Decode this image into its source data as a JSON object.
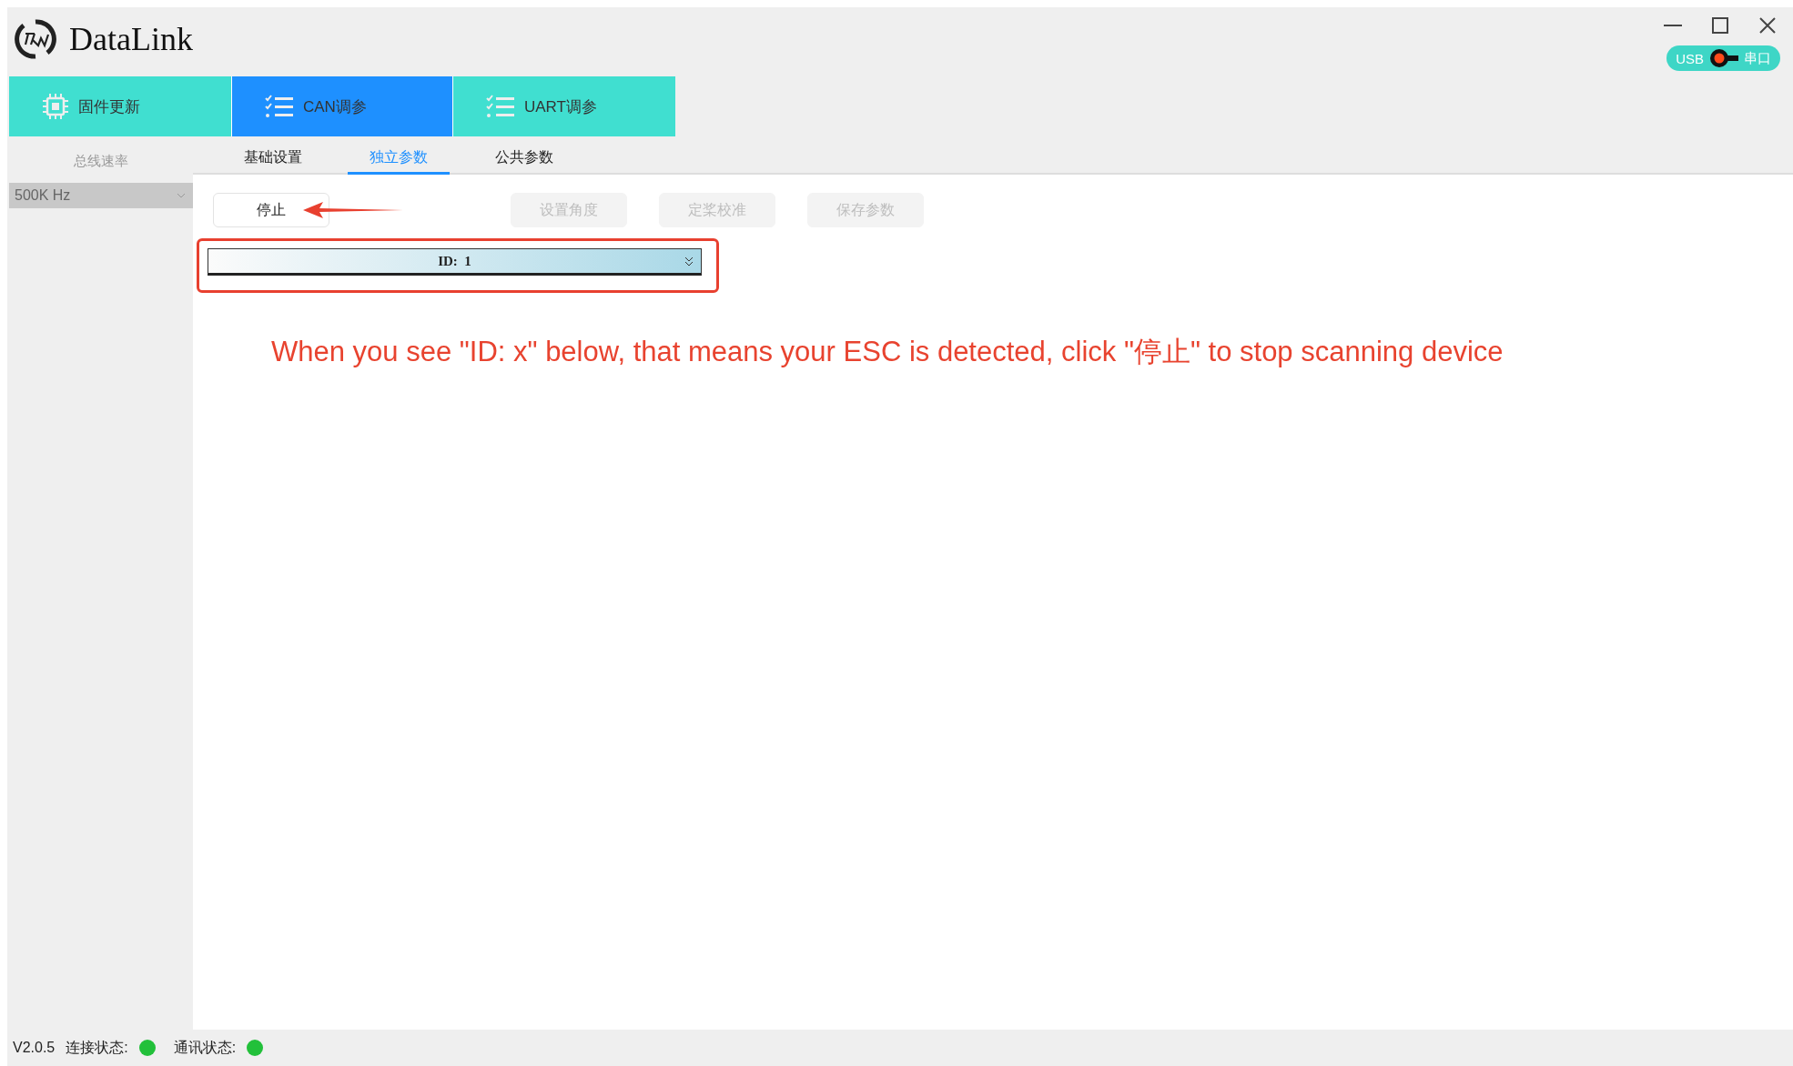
{
  "window": {
    "title": "DataLink"
  },
  "window_controls": [
    {
      "kind": "minimize"
    },
    {
      "kind": "maximize"
    },
    {
      "kind": "close"
    }
  ],
  "connection_switch": {
    "left_label": "USB",
    "right_label": "串口",
    "on": false
  },
  "nav_tabs": [
    {
      "label": "固件更新",
      "kind": "firmware",
      "selected": false
    },
    {
      "label": "CAN调参",
      "kind": "tuning",
      "selected": true
    },
    {
      "label": "UART调参",
      "kind": "tuning",
      "selected": false
    }
  ],
  "sidebar": {
    "label": "总线速率",
    "select": {
      "value": "500K Hz",
      "disabled": true
    }
  },
  "sub_tabs": [
    {
      "label": "基础设置",
      "selected": false
    },
    {
      "label": "独立参数",
      "selected": true
    },
    {
      "label": "公共参数",
      "selected": false
    }
  ],
  "toolbar": [
    {
      "label": "停止",
      "disabled": false
    },
    {
      "label": "设置角度",
      "disabled": true
    },
    {
      "label": "定桨校准",
      "disabled": true
    },
    {
      "label": "保存参数",
      "disabled": true
    }
  ],
  "device_list": [
    {
      "label": "ID:  1",
      "expanded": false
    }
  ],
  "annotation": {
    "text": "When you see \"ID: x\" below, that means your ESC is detected, click \"停止\" to stop scanning device"
  },
  "status_bar": {
    "version": "V2.0.5",
    "indicators": [
      {
        "label": "连接状态:",
        "color": "#22c03a"
      },
      {
        "label": "通讯状态:",
        "color": "#22c03a"
      }
    ]
  }
}
